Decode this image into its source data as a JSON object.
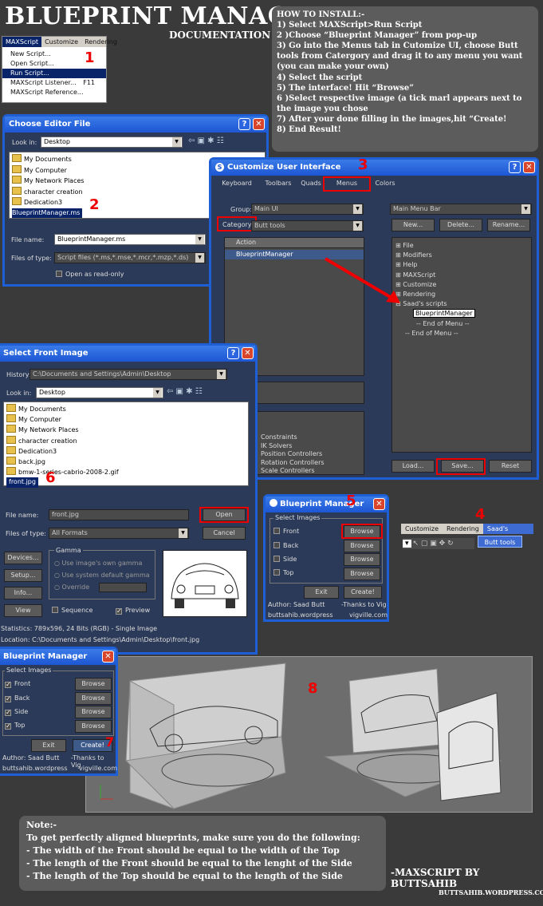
{
  "header": {
    "title": "BLUEPRINT MANAGER",
    "subtitle": "DOCUMENTATION"
  },
  "howto": {
    "heading": "HOW TO INSTALL:-",
    "steps": [
      "1) Select MAXScript>Run Script",
      "2 )Choose “Blueprint Manager” from pop-up",
      "3) Go into the Menus tab in Cutomize UI, choose Butt tools from Catergory and drag it to any menu you want",
      "(you can make your own)",
      "4) Select the script",
      "5) The interface! Hit “Browse”",
      "6 )Select respective image (a tick marl appears next to the image you chose",
      "7) After your done filling in the images,hit “Create!",
      "8) End Result!"
    ]
  },
  "menu": {
    "bar": [
      "MAXScript",
      "Customize",
      "Rendering"
    ],
    "items": [
      "New Script...",
      "Open Script...",
      "Run Script...",
      "MAXScript Listener...",
      "MAXScript Reference..."
    ],
    "shortcut": "F11"
  },
  "step_numbers": [
    "1",
    "2",
    "3",
    "4",
    "5",
    "6",
    "7",
    "8"
  ],
  "choose_editor": {
    "title": "Choose Editor File",
    "look_in_label": "Look in:",
    "look_in_value": "Desktop",
    "files": [
      "My Documents",
      "My Computer",
      "My Network Places",
      "character creation",
      "Dedication3",
      "BlueprintManager.ms"
    ],
    "file_name_label": "File name:",
    "file_name_value": "BlueprintManager.ms",
    "file_type_label": "Files of type:",
    "file_type_value": "Script files (*.ms,*.mse,*.mcr,*.mzp,*.ds)",
    "readonly_label": "Open as read-only"
  },
  "customize_ui": {
    "title": "Customize User Interface",
    "tabs": [
      "Keyboard",
      "Toolbars",
      "Quads",
      "Menus",
      "Colors"
    ],
    "group_label": "Group:",
    "group_value": "Main UI",
    "category_label": "Category:",
    "category_value": "Butt tools",
    "action_header": "Action",
    "action_item": "BlueprintManager",
    "menu_bar_value": "Main Menu Bar",
    "buttons_top": [
      "New...",
      "Delete...",
      "Rename..."
    ],
    "tree": [
      "File",
      "Modifiers",
      "Help",
      "MAXScript",
      "Customize",
      "Rendering",
      "Saad's scripts",
      "BlueprintManager",
      "-- End of Menu --",
      "-- End of Menu --"
    ],
    "lower_list": [
      "Constraints",
      "IK Solvers",
      "Position Controllers",
      "Rotation Controllers",
      "Scale Controllers"
    ],
    "buttons_bottom": [
      "Load...",
      "Save...",
      "Reset"
    ]
  },
  "select_front": {
    "title": "Select Front Image",
    "history_label": "History:",
    "history_value": "C:\\Documents and Settings\\Admin\\Desktop",
    "look_in_label": "Look in:",
    "look_in_value": "Desktop",
    "files": [
      "My Documents",
      "My Computer",
      "My Network Places",
      "character creation",
      "Dedication3",
      "back.jpg",
      "bmw-1-series-cabrio-2008-2.gif",
      "front.jpg"
    ],
    "file_name_label": "File name:",
    "file_name_value": "front.jpg",
    "file_type_label": "Files of type:",
    "file_type_value": "All Formats",
    "open": "Open",
    "cancel": "Cancel",
    "side_buttons": [
      "Devices...",
      "Setup...",
      "Info...",
      "View"
    ],
    "gamma_label": "Gamma",
    "gamma_options": [
      "Use image's own gamma",
      "Use system default gamma",
      "Override"
    ],
    "sequence": "Sequence",
    "preview": "Preview",
    "statistics": "Statistics:  789x596, 24 Bits (RGB) - Single Image",
    "location": "Location:  C:\\Documents and Settings\\Admin\\Desktop\\front.jpg"
  },
  "bm_small": {
    "title": "Blueprint Manager",
    "group": "Select Images",
    "rows": [
      "Front",
      "Back",
      "Side",
      "Top"
    ],
    "browse": "Browse",
    "exit": "Exit",
    "create": "Create!",
    "author": "Author: Saad Butt",
    "thanks": "-Thanks to Vig",
    "site1": "buttsahib.wordpress",
    "site2": "vigville.com"
  },
  "toolbar4": {
    "items": [
      "Customize",
      "Rendering",
      "Saad's scripts"
    ],
    "submenu": "Butt tools"
  },
  "note": {
    "title": "Note:-",
    "lines": [
      "To get perfectly aligned blueprints, make sure you do the following:",
      "- The width of the Front should be equal to the width of the Top",
      "- The length of the Front should be equal to the lenght of the Side",
      "- The length of the Top should be equal to the length of the Side"
    ]
  },
  "credit": "-MAXSCRIPT BY BUTTSAHIB",
  "url": "BUTTSAHIB.WORDPRESS.COM"
}
